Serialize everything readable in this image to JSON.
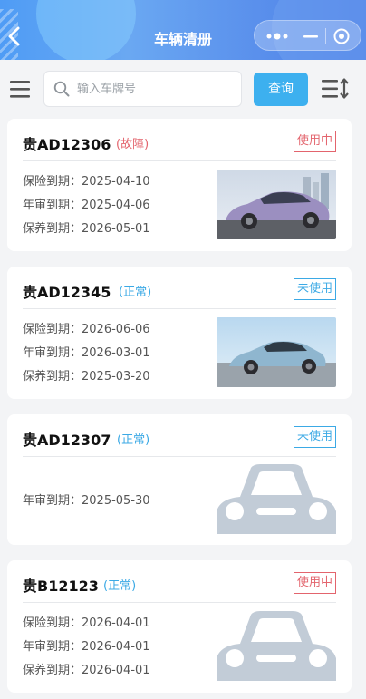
{
  "header": {
    "title": "车辆清册",
    "back_icon": "chevron-left-icon",
    "capsule_icons": [
      "more-dots-icon",
      "minimize-icon",
      "close-circle-icon"
    ]
  },
  "toolbar": {
    "menu_icon": "hamburger-menu-icon",
    "search_placeholder": "输入车牌号",
    "search_value": "",
    "query_label": "查询",
    "sort_icon": "sort-list-icon"
  },
  "colors": {
    "header_gradient_start": "#4f9cf5",
    "header_gradient_end": "#4d7fe6",
    "query_button": "#3db0ef",
    "fault_red": "#e3646d",
    "normal_blue": "#3ba9e5",
    "page_background": "#f3f4f6"
  },
  "vehicles": [
    {
      "plate": "贵AD12306",
      "status": "(故障)",
      "status_type": "fault",
      "badge": "使用中",
      "badge_type": "using",
      "lines": [
        "保险到期：2025-04-10",
        "年审到期：2025-04-06",
        "保养到期：2026-05-01"
      ],
      "image": "purple-sedan-photo"
    },
    {
      "plate": "贵AD12345",
      "status": "(正常)",
      "status_type": "normal",
      "badge": "未使用",
      "badge_type": "unused",
      "lines": [
        "保险到期：2026-06-06",
        "年审到期：2026-03-01",
        "保养到期：2025-03-20"
      ],
      "image": "blue-sedan-photo"
    },
    {
      "plate": "贵AD12307",
      "status": "(正常)",
      "status_type": "normal",
      "badge": "未使用",
      "badge_type": "unused",
      "lines": [
        "年审到期：2025-05-30"
      ],
      "image": "car-placeholder-icon"
    },
    {
      "plate": "贵B12123",
      "status": "(正常)",
      "status_type": "normal",
      "badge": "使用中",
      "badge_type": "using",
      "lines": [
        "保险到期：2026-04-01",
        "年审到期：2026-04-01",
        "保养到期：2026-04-01"
      ],
      "image": "car-placeholder-icon"
    }
  ]
}
